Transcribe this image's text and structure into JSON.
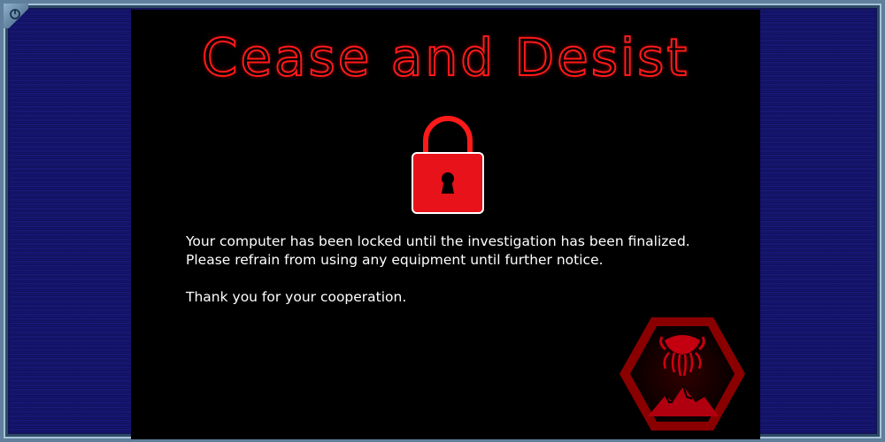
{
  "window": {
    "power_icon": "power-icon"
  },
  "notice": {
    "title": "Cease and Desist",
    "lock_icon": "padlock-icon",
    "line1": "Your computer has been locked until the investigation has been finalized.",
    "line2": "Please refrain from using any equipment until further notice.",
    "line3": "Thank you for your cooperation.",
    "emblem_icon": "hexagon-tentacle-emblem-icon"
  },
  "colors": {
    "accent_red": "#ff1a1a",
    "screen_bg": "#000000",
    "frame": "#5f7f9c",
    "side_panel": "#14145a"
  }
}
